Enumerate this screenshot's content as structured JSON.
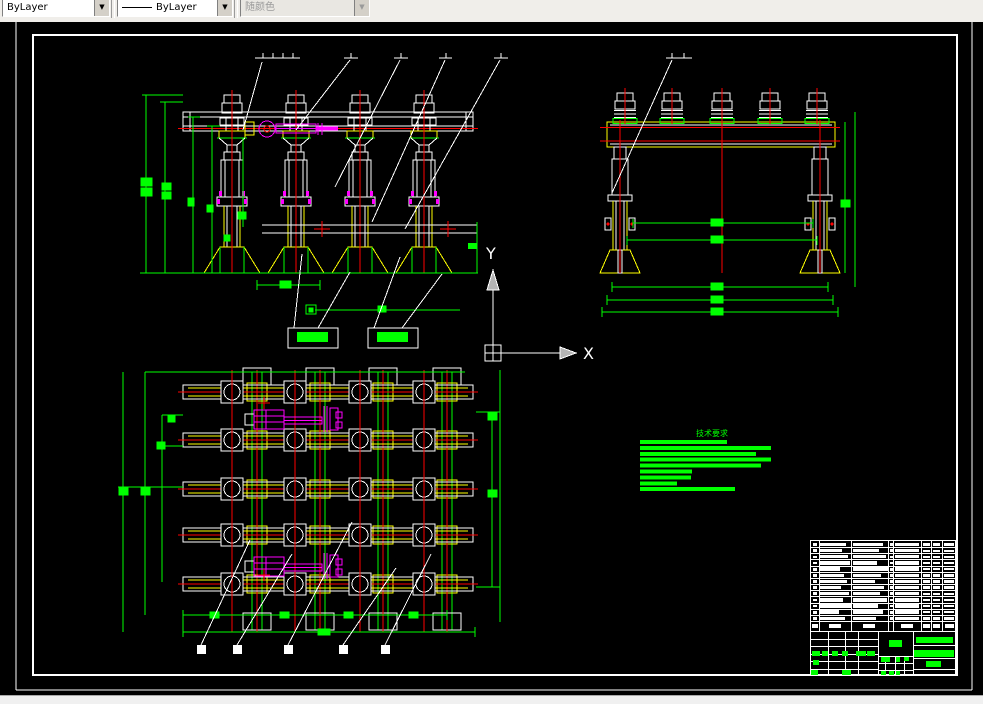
{
  "toolbar": {
    "color_control": {
      "value": "ByLayer",
      "disabled": false
    },
    "linetype_control": {
      "value": "ByLayer",
      "disabled": false
    },
    "plotstyle_control": {
      "value": "随颜色",
      "disabled": true
    },
    "dropdown_icon": "chevron-down"
  },
  "ucs": {
    "x_label": "X",
    "y_label": "Y"
  },
  "notes": {
    "title": "技术要求",
    "line_widths": [
      87,
      131,
      116,
      131,
      121,
      52,
      51,
      37,
      95
    ]
  },
  "parts_list": {
    "row_count": 13,
    "rows": [
      {
        "name_w": 26,
        "col2_w": 30
      },
      {
        "name_w": 22,
        "col2_w": 26
      },
      {
        "name_w": 28,
        "col2_w": 33
      },
      {
        "name_w": 30,
        "col2_w": 24
      },
      {
        "name_w": 20,
        "col2_w": 35
      },
      {
        "name_w": 24,
        "col2_w": 28
      },
      {
        "name_w": 27,
        "col2_w": 22
      },
      {
        "name_w": 21,
        "col2_w": 31
      },
      {
        "name_w": 29,
        "col2_w": 27
      },
      {
        "name_w": 23,
        "col2_w": 34
      },
      {
        "name_w": 31,
        "col2_w": 25
      },
      {
        "name_w": 19,
        "col2_w": 30
      },
      {
        "name_w": 25,
        "col2_w": 23
      }
    ],
    "material_bar_w": 24,
    "header_blobs": [
      [
        1,
        83,
        6,
        4
      ],
      [
        18,
        83,
        12,
        4
      ],
      [
        52,
        83,
        12,
        4
      ],
      [
        90,
        83,
        12,
        4
      ],
      [
        111.5,
        83,
        7,
        4
      ],
      [
        121.5,
        83,
        7,
        4
      ],
      [
        133.5,
        83,
        9,
        4
      ]
    ]
  },
  "title_block": {
    "green_blobs": [
      [
        78,
        99,
        13,
        7
      ],
      [
        1,
        110,
        8,
        5
      ],
      [
        11,
        110,
        6,
        5
      ],
      [
        21,
        110,
        6,
        5
      ],
      [
        31,
        110,
        6,
        5
      ],
      [
        45,
        110,
        10,
        5
      ],
      [
        56,
        110,
        8,
        5
      ],
      [
        2,
        119,
        6,
        5
      ],
      [
        0,
        129,
        7,
        5
      ],
      [
        31,
        129,
        9,
        5
      ],
      [
        70,
        116,
        9,
        5
      ],
      [
        85,
        116,
        4,
        5
      ],
      [
        93,
        116,
        5,
        4
      ],
      [
        70,
        130,
        5,
        4
      ],
      [
        78,
        130,
        5,
        4
      ],
      [
        85,
        130,
        4,
        4
      ],
      [
        105,
        96,
        37,
        6
      ],
      [
        103,
        109,
        40,
        7
      ],
      [
        115,
        120,
        15,
        6
      ]
    ]
  },
  "colors": {
    "outline": "#ffffff",
    "dimension": "#00ff00",
    "centerline": "#ff0000",
    "auxiliary": "#ffff00",
    "highlight": "#ff00ff"
  }
}
